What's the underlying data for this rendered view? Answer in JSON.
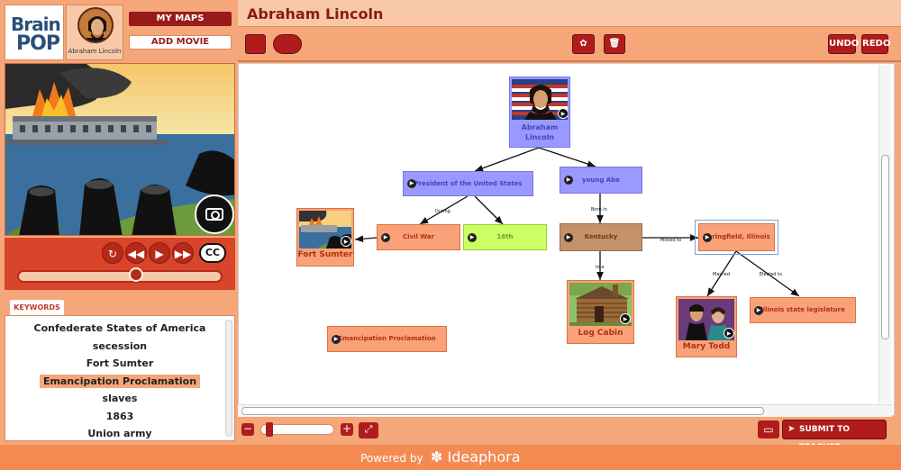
{
  "app": {
    "title": "Abraham Lincoln"
  },
  "sidebar": {
    "logo_top": "Brain",
    "logo_bottom": "POP",
    "avatar_name": "Abraham Lincoln",
    "my_maps_label": "MY MAPS",
    "add_movie_label": "ADD MOVIE",
    "cc_label": "CC",
    "keywords_tab": "KEYWORDS",
    "keywords": [
      "Confederate States of America",
      "secession",
      "Fort Sumter",
      "Emancipation Proclamation",
      "slaves",
      "1863",
      "Union army"
    ],
    "selected_keyword_index": 3
  },
  "toolbar": {
    "undo_label": "UNDO",
    "redo_label": "REDO"
  },
  "map": {
    "root": "Abraham Lincoln",
    "president": "President of the United States",
    "young_abe": "young Abe",
    "civil_war": "Civil War",
    "sixteenth": "16th",
    "kentucky": "Kentucky",
    "springfield": "Springfield, Illinois",
    "fort_sumter": "Fort Sumter",
    "log_cabin": "Log Cabin",
    "mary_todd": "Mary Todd",
    "illinois_leg": "Illinois state legislature",
    "emancipation": "Emancipation Proclamation",
    "edge_during": "During",
    "edge_born_in": "Born in",
    "edge_moved_to": "Moved to",
    "edge_in_a": "In a",
    "edge_married": "Married",
    "edge_elected_to": "Elected to"
  },
  "footer": {
    "submit_label": "SUBMIT TO TEACHER",
    "powered_by": "Powered by",
    "brand": "Ideaphora"
  },
  "colors": {
    "brand_red": "#b01c1c",
    "orange": "#f5a77a",
    "purple_node": "#9999ff",
    "peach_node": "#f9a27a"
  }
}
